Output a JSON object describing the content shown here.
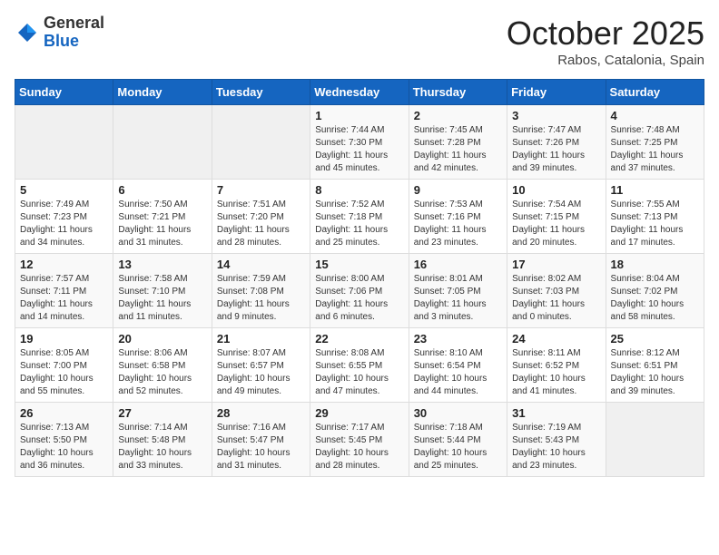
{
  "header": {
    "logo_general": "General",
    "logo_blue": "Blue",
    "month": "October 2025",
    "location": "Rabos, Catalonia, Spain"
  },
  "days_of_week": [
    "Sunday",
    "Monday",
    "Tuesday",
    "Wednesday",
    "Thursday",
    "Friday",
    "Saturday"
  ],
  "weeks": [
    [
      {
        "day": "",
        "info": ""
      },
      {
        "day": "",
        "info": ""
      },
      {
        "day": "",
        "info": ""
      },
      {
        "day": "1",
        "info": "Sunrise: 7:44 AM\nSunset: 7:30 PM\nDaylight: 11 hours\nand 45 minutes."
      },
      {
        "day": "2",
        "info": "Sunrise: 7:45 AM\nSunset: 7:28 PM\nDaylight: 11 hours\nand 42 minutes."
      },
      {
        "day": "3",
        "info": "Sunrise: 7:47 AM\nSunset: 7:26 PM\nDaylight: 11 hours\nand 39 minutes."
      },
      {
        "day": "4",
        "info": "Sunrise: 7:48 AM\nSunset: 7:25 PM\nDaylight: 11 hours\nand 37 minutes."
      }
    ],
    [
      {
        "day": "5",
        "info": "Sunrise: 7:49 AM\nSunset: 7:23 PM\nDaylight: 11 hours\nand 34 minutes."
      },
      {
        "day": "6",
        "info": "Sunrise: 7:50 AM\nSunset: 7:21 PM\nDaylight: 11 hours\nand 31 minutes."
      },
      {
        "day": "7",
        "info": "Sunrise: 7:51 AM\nSunset: 7:20 PM\nDaylight: 11 hours\nand 28 minutes."
      },
      {
        "day": "8",
        "info": "Sunrise: 7:52 AM\nSunset: 7:18 PM\nDaylight: 11 hours\nand 25 minutes."
      },
      {
        "day": "9",
        "info": "Sunrise: 7:53 AM\nSunset: 7:16 PM\nDaylight: 11 hours\nand 23 minutes."
      },
      {
        "day": "10",
        "info": "Sunrise: 7:54 AM\nSunset: 7:15 PM\nDaylight: 11 hours\nand 20 minutes."
      },
      {
        "day": "11",
        "info": "Sunrise: 7:55 AM\nSunset: 7:13 PM\nDaylight: 11 hours\nand 17 minutes."
      }
    ],
    [
      {
        "day": "12",
        "info": "Sunrise: 7:57 AM\nSunset: 7:11 PM\nDaylight: 11 hours\nand 14 minutes."
      },
      {
        "day": "13",
        "info": "Sunrise: 7:58 AM\nSunset: 7:10 PM\nDaylight: 11 hours\nand 11 minutes."
      },
      {
        "day": "14",
        "info": "Sunrise: 7:59 AM\nSunset: 7:08 PM\nDaylight: 11 hours\nand 9 minutes."
      },
      {
        "day": "15",
        "info": "Sunrise: 8:00 AM\nSunset: 7:06 PM\nDaylight: 11 hours\nand 6 minutes."
      },
      {
        "day": "16",
        "info": "Sunrise: 8:01 AM\nSunset: 7:05 PM\nDaylight: 11 hours\nand 3 minutes."
      },
      {
        "day": "17",
        "info": "Sunrise: 8:02 AM\nSunset: 7:03 PM\nDaylight: 11 hours\nand 0 minutes."
      },
      {
        "day": "18",
        "info": "Sunrise: 8:04 AM\nSunset: 7:02 PM\nDaylight: 10 hours\nand 58 minutes."
      }
    ],
    [
      {
        "day": "19",
        "info": "Sunrise: 8:05 AM\nSunset: 7:00 PM\nDaylight: 10 hours\nand 55 minutes."
      },
      {
        "day": "20",
        "info": "Sunrise: 8:06 AM\nSunset: 6:58 PM\nDaylight: 10 hours\nand 52 minutes."
      },
      {
        "day": "21",
        "info": "Sunrise: 8:07 AM\nSunset: 6:57 PM\nDaylight: 10 hours\nand 49 minutes."
      },
      {
        "day": "22",
        "info": "Sunrise: 8:08 AM\nSunset: 6:55 PM\nDaylight: 10 hours\nand 47 minutes."
      },
      {
        "day": "23",
        "info": "Sunrise: 8:10 AM\nSunset: 6:54 PM\nDaylight: 10 hours\nand 44 minutes."
      },
      {
        "day": "24",
        "info": "Sunrise: 8:11 AM\nSunset: 6:52 PM\nDaylight: 10 hours\nand 41 minutes."
      },
      {
        "day": "25",
        "info": "Sunrise: 8:12 AM\nSunset: 6:51 PM\nDaylight: 10 hours\nand 39 minutes."
      }
    ],
    [
      {
        "day": "26",
        "info": "Sunrise: 7:13 AM\nSunset: 5:50 PM\nDaylight: 10 hours\nand 36 minutes."
      },
      {
        "day": "27",
        "info": "Sunrise: 7:14 AM\nSunset: 5:48 PM\nDaylight: 10 hours\nand 33 minutes."
      },
      {
        "day": "28",
        "info": "Sunrise: 7:16 AM\nSunset: 5:47 PM\nDaylight: 10 hours\nand 31 minutes."
      },
      {
        "day": "29",
        "info": "Sunrise: 7:17 AM\nSunset: 5:45 PM\nDaylight: 10 hours\nand 28 minutes."
      },
      {
        "day": "30",
        "info": "Sunrise: 7:18 AM\nSunset: 5:44 PM\nDaylight: 10 hours\nand 25 minutes."
      },
      {
        "day": "31",
        "info": "Sunrise: 7:19 AM\nSunset: 5:43 PM\nDaylight: 10 hours\nand 23 minutes."
      },
      {
        "day": "",
        "info": ""
      }
    ]
  ]
}
